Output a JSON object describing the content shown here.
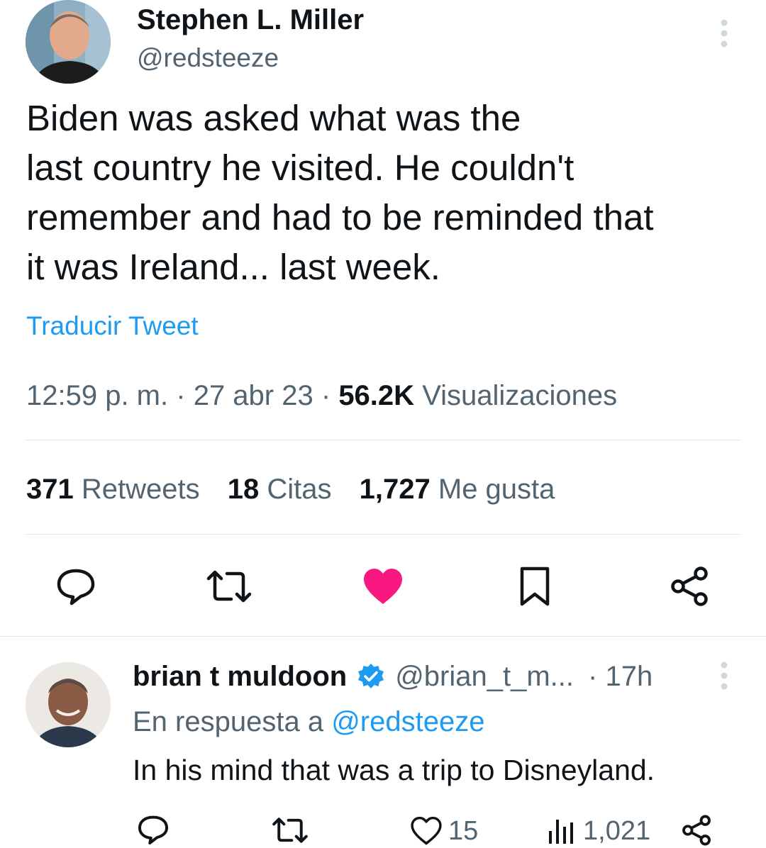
{
  "tweet": {
    "author_name": "Stephen L. Miller",
    "handle": "@redsteeze",
    "text_lines": [
      "Biden was asked what was the",
      "last country he visited. He couldn't",
      "remember and had to be reminded that",
      "it was Ireland... last week."
    ],
    "translate_label": "Traducir Tweet",
    "time": "12:59 p. m.",
    "date": "27 abr 23",
    "views_count": "56.2K",
    "views_label": "Visualizaciones",
    "sep": "·",
    "stats": {
      "retweets_count": "371",
      "retweets_label": "Retweets",
      "quotes_count": "18",
      "quotes_label": "Citas",
      "likes_count": "1,727",
      "likes_label": "Me gusta"
    },
    "liked": true
  },
  "reply": {
    "author_name": "brian t muldoon",
    "handle": "@brian_t_m...",
    "time": "· 17h",
    "in_reply_prefix": "En respuesta a",
    "in_reply_handle": "@redsteeze",
    "text": "In his mind that was a trip to Disneyland.",
    "likes": "15",
    "views": "1,021",
    "verified": true
  },
  "colors": {
    "accent": "#1d9bf0",
    "like": "#f91880",
    "text": "#0f1419",
    "muted": "#536471"
  }
}
